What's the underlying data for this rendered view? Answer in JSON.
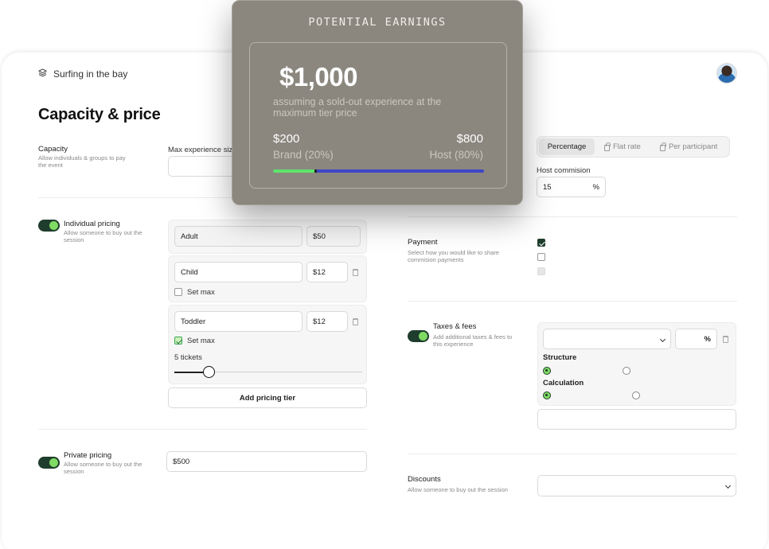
{
  "breadcrumb": {
    "icon": "layers-icon",
    "label": "Surfing in the bay"
  },
  "page_title": "Capacity & price",
  "capacity": {
    "title": "Capacity",
    "description": "Allow individuals & groups to pay the event",
    "max_label": "Max experience siz",
    "max_value": ""
  },
  "individual_pricing": {
    "title": "Individual pricing",
    "description": "Allow someone to buy out the session",
    "enabled": true,
    "tiers": [
      {
        "name": "Adult",
        "price": "$50"
      },
      {
        "name": "Child",
        "price": "$12",
        "set_max_label": "Set max",
        "set_max": false
      },
      {
        "name": "Toddler",
        "price": "$12",
        "set_max_label": "Set max",
        "set_max": true,
        "tickets_label": "5 tickets",
        "tickets": 5
      }
    ],
    "add_tier_label": "Add pricing tier"
  },
  "private_pricing": {
    "title": "Private pricing",
    "description": "Allow someone to buy out the session",
    "enabled": true,
    "value": "$500"
  },
  "commission": {
    "options": [
      {
        "label": "Percentage",
        "active": true,
        "locked": false
      },
      {
        "label": "Flat rate",
        "active": false,
        "locked": true
      },
      {
        "label": "Per participant",
        "active": false,
        "locked": true
      }
    ],
    "host_label": "Host commision",
    "host_value": "15",
    "host_unit": "%"
  },
  "payment": {
    "title": "Payment",
    "description": "Select how you would like to share commision payments",
    "checkboxes": [
      "checked",
      "unchecked",
      "disabled"
    ]
  },
  "taxes": {
    "title": "Taxes & fees",
    "description": "Add additional taxes & fees to this experience",
    "enabled": true,
    "select_value": "",
    "percent_value": "",
    "percent_unit": "%",
    "structure_label": "Structure",
    "calculation_label": "Calculation"
  },
  "discounts": {
    "title": "Discounts",
    "description": "Allow someone to buy out the session",
    "select_value": ""
  },
  "earnings_popup": {
    "title": "POTENTIAL EARNINGS",
    "amount": "$1,000",
    "description": "assuming a sold-out experience at the maximum tier price",
    "brand_value": "$200",
    "brand_label": "Brand (20%)",
    "host_value": "$800",
    "host_label": "Host (80%)",
    "brand_share": 0.2,
    "colors": {
      "brand_bar": "#5ee46a",
      "host_bar": "#3f47c9",
      "background": "#8b877f"
    }
  },
  "colors": {
    "toggle_track": "#1f3d2c",
    "toggle_knob": "#7fdb63"
  }
}
